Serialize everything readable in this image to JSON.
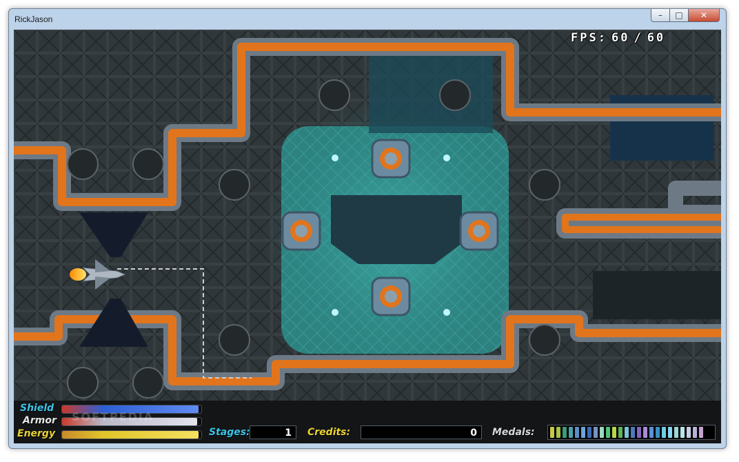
{
  "window": {
    "title": "RickJason",
    "minimize": "–",
    "maximize": "□",
    "close": "✕"
  },
  "fps": {
    "label": "FPS:",
    "current": "60",
    "separator": "/",
    "target": "60"
  },
  "hud": {
    "shield": {
      "label": "Shield",
      "level": 0.98
    },
    "armor": {
      "label": "Armor",
      "level": 0.97
    },
    "energy": {
      "label": "Energy",
      "level": 0.98
    },
    "stages": {
      "label": "Stages:",
      "value": "1"
    },
    "credits": {
      "label": "Credits:",
      "value": "0"
    },
    "medals": {
      "label": "Medals:",
      "count": 25,
      "colors": [
        "#c8c84a",
        "#a8c246",
        "#3a9d7a",
        "#49a0b0",
        "#5d8fc6",
        "#6fa3d9",
        "#3d6bb0",
        "#7a90c4",
        "#9bd7c1",
        "#4ec27b",
        "#b9d649",
        "#5fb35f",
        "#7dc2d6",
        "#4b7bc0",
        "#8466c0",
        "#a98ad6",
        "#5e90d6",
        "#3b8fc2",
        "#6fcde0",
        "#89d4ee",
        "#9ad7d7",
        "#b7e3ec",
        "#c6cfe3",
        "#b9b0d8",
        "#c4a3d0"
      ]
    },
    "watermark": "SOFTPEDIA"
  },
  "colors": {
    "lava": "#e2741c",
    "metal": "#6d7a86",
    "floor": "#2f3538",
    "reactor": "#2f8d8a",
    "hud_label": "#3cc4e6",
    "armor_label": "#e6e6e6",
    "energy_label": "#e8d235",
    "shield_bar": "#2d5ed6",
    "armor_bar": "#b9b9c8",
    "energy_bar": "#e0c52a"
  }
}
